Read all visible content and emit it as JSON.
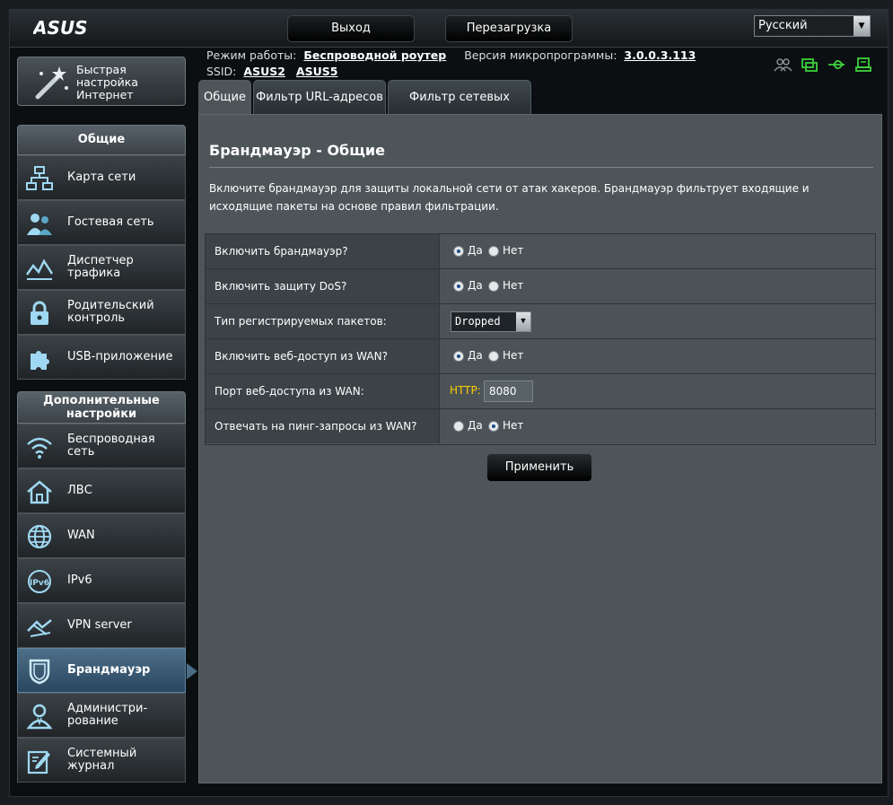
{
  "header": {
    "logo": "ASUS",
    "logout_label": "Выход",
    "reboot_label": "Перезагрузка",
    "language": "Русский"
  },
  "info": {
    "mode_label": "Режим работы:",
    "mode_value": "Беспроводной роутер",
    "firmware_label": "Версия микропрограммы:",
    "firmware_value": "3.0.0.3.113",
    "ssid_label": "SSID:",
    "ssid_1": "ASUS2",
    "ssid_2": "ASUS5"
  },
  "sidebar": {
    "quick_setup": [
      "Быстрая",
      "настройка",
      "Интернет"
    ],
    "general_header": "Общие",
    "general_items": [
      {
        "lines": [
          "Карта сети"
        ],
        "icon": "network-map-icon"
      },
      {
        "lines": [
          "Гостевая сеть"
        ],
        "icon": "guest-network-icon"
      },
      {
        "lines": [
          "Диспетчер",
          "трафика"
        ],
        "icon": "traffic-manager-icon"
      },
      {
        "lines": [
          "Родительский",
          "контроль"
        ],
        "icon": "parental-control-icon"
      },
      {
        "lines": [
          "USB-приложение"
        ],
        "icon": "usb-app-icon"
      }
    ],
    "advanced_header": [
      "Дополнительные",
      "настройки"
    ],
    "advanced_items": [
      {
        "lines": [
          "Беспроводная",
          "сеть"
        ],
        "icon": "wireless-icon"
      },
      {
        "lines": [
          "ЛВС"
        ],
        "icon": "lan-icon"
      },
      {
        "lines": [
          "WAN"
        ],
        "icon": "wan-icon"
      },
      {
        "lines": [
          "IPv6"
        ],
        "icon": "ipv6-icon"
      },
      {
        "lines": [
          "VPN server"
        ],
        "icon": "vpn-icon"
      },
      {
        "lines": [
          "Брандмауэр"
        ],
        "icon": "firewall-icon",
        "active": true
      },
      {
        "lines": [
          "Администри-",
          "рование"
        ],
        "icon": "admin-icon"
      },
      {
        "lines": [
          "Системный",
          "журнал"
        ],
        "icon": "syslog-icon"
      }
    ]
  },
  "tabs": [
    "Общие",
    "Фильтр URL-адресов",
    "Фильтр сетевых служб"
  ],
  "main": {
    "title": "Брандмауэр - Общие",
    "description": "Включите брандмауэр для защиты локальной сети от атак хакеров. Брандмауэр фильтрует входящие и исходящие пакеты на основе правил фильтрации.",
    "yes": "Да",
    "no": "Нет",
    "rows": {
      "firewall": {
        "label": "Включить брандмауэр?",
        "value": "yes"
      },
      "dos": {
        "label": "Включить защиту DoS?",
        "value": "yes"
      },
      "log_type": {
        "label": "Тип регистрируемых пакетов:",
        "value": "Dropped"
      },
      "wan_web": {
        "label": "Включить веб-доступ из WAN?",
        "value": "yes"
      },
      "wan_port": {
        "label": "Порт веб-доступа из WAN:",
        "prefix": "HTTP:",
        "value": "8080"
      },
      "ping": {
        "label": "Отвечать на пинг-запросы из WAN?",
        "value": "no"
      }
    },
    "apply_label": "Применить"
  },
  "colors": {
    "accent_green": "#3dd13d",
    "http_label": "#ffcc00",
    "active_nav": "#2a4660"
  }
}
